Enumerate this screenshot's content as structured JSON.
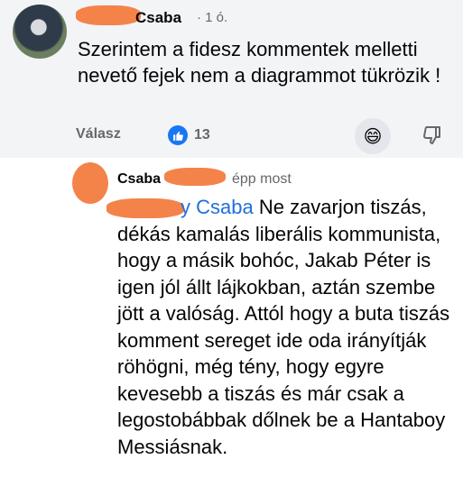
{
  "comment": {
    "author_name": "Csaba",
    "time": "· 1 ó.",
    "text": "Szerintem a fidesz kommentek melletti nevető fejek nem a diagrammot tükrözik !",
    "reply_label": "Válasz",
    "like_count": "13",
    "reaction_emoji": "😄"
  },
  "reply": {
    "author_name": "Csaba",
    "time": "épp most",
    "mention": "y Csaba",
    "text": " Ne zavarjon tiszás, dékás kamalás liberális kommunista, hogy a másik bohóc, Jakab Péter is igen jól állt lájkokban, aztán szembe jött a valóság. Attól hogy a buta tiszás komment sereget ide oda irányítják röhögni, még tény, hogy egyre kevesebb a tiszás és már csak a legostobábbak dőlnek be a Hantaboy Messiásnak."
  },
  "colors": {
    "accent": "#1877f2",
    "mention": "#216fdb",
    "muted": "#65676b",
    "redaction": "#f4834a"
  }
}
